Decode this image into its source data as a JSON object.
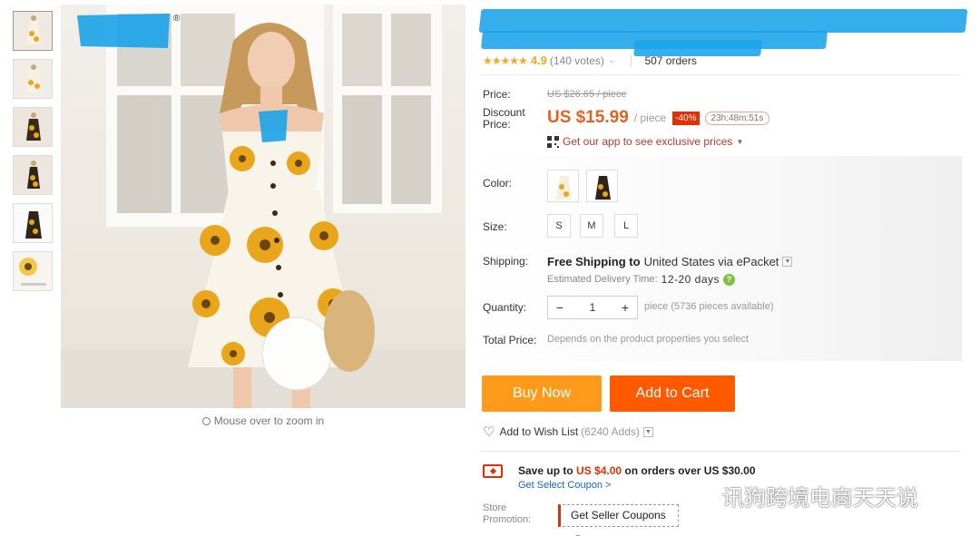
{
  "gallery": {
    "thumbnails": [
      {
        "name": "thumb-front"
      },
      {
        "name": "thumb-side"
      },
      {
        "name": "thumb-back"
      },
      {
        "name": "thumb-detail"
      },
      {
        "name": "thumb-flat-lay"
      },
      {
        "name": "thumb-fabric"
      }
    ],
    "zoom_hint": "Mouse over to zoom in"
  },
  "product": {
    "rating_stars": "★★★★★",
    "rating_score": "4.9",
    "votes": "(140 votes)",
    "orders": "507 orders"
  },
  "pricing": {
    "price_label": "Price:",
    "original_price": "US $26.65 / piece",
    "discount_label": "Discount\nPrice:",
    "discount_price": "US $15.99",
    "unit": "/ piece",
    "discount_badge": "-40%",
    "countdown": "23h:48m:51s",
    "app_promo": "Get our app to see exclusive prices"
  },
  "options": {
    "color_label": "Color:",
    "size_label": "Size:",
    "sizes": [
      "S",
      "M",
      "L"
    ]
  },
  "shipping": {
    "label": "Shipping:",
    "free_text": "Free Shipping to",
    "destination": "United States via ePacket",
    "estimate_label": "Estimated Delivery Time:",
    "estimate_value": "12-20 days"
  },
  "quantity": {
    "label": "Quantity:",
    "value": "1",
    "minus": "−",
    "plus": "+",
    "available": "piece (5736 pieces available)"
  },
  "total": {
    "label": "Total Price:",
    "note": "Depends on the product properties you select"
  },
  "actions": {
    "buy_now": "Buy Now",
    "add_to_cart": "Add to Cart",
    "wishlist": "Add to Wish List",
    "wishlist_adds": "(6240 Adds)"
  },
  "coupon": {
    "save_prefix": "Save up to",
    "save_amount": "US $4.00",
    "save_suffix": "on orders over US $30.00",
    "link": "Get Select Coupon >",
    "store_promo_label": "Store\nPromotion:",
    "seller_coupon": "Get Seller Coupons"
  },
  "watermark": "讯狗跨境电商天天说",
  "colors": {
    "accent_orange": "#ff9a1a",
    "cart_orange": "#ff5a00",
    "price_orange": "#e5611e",
    "badge_red": "#e62e04",
    "star_color": "#f5a623",
    "redaction_blue": "#1aa3e8"
  }
}
